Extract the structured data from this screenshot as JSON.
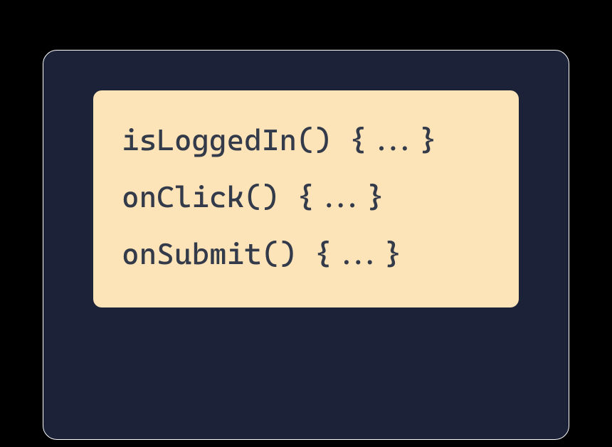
{
  "code": {
    "lines": [
      "isLoggedIn() {...}",
      "onClick() {...}",
      "onSubmit() {...}"
    ]
  },
  "colors": {
    "outer_bg": "#000000",
    "panel_bg": "#1c2237",
    "panel_border": "#ffffff",
    "code_bg": "#fce4b8",
    "code_text": "#333a4a"
  }
}
